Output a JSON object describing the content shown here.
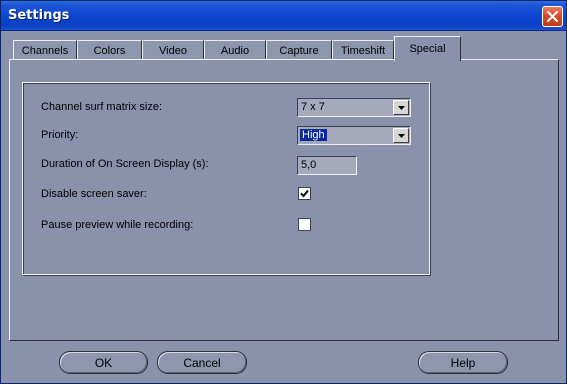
{
  "window": {
    "title": "Settings",
    "close_icon": "close-x-icon"
  },
  "tabs": [
    {
      "label": "Channels",
      "active": false
    },
    {
      "label": "Colors",
      "active": false
    },
    {
      "label": "Video",
      "active": false
    },
    {
      "label": "Audio",
      "active": false
    },
    {
      "label": "Capture",
      "active": false
    },
    {
      "label": "Timeshift",
      "active": false
    },
    {
      "label": "Special",
      "active": true
    }
  ],
  "special": {
    "surf_matrix": {
      "label": "Channel surf matrix size:",
      "value": "7 x 7"
    },
    "priority": {
      "label": "Priority:",
      "value": "High"
    },
    "osd_duration": {
      "label": "Duration of On Screen Display (s):",
      "value": "5,0"
    },
    "disable_screensaver": {
      "label": "Disable screen saver:",
      "checked": true
    },
    "pause_preview": {
      "label": "Pause preview while recording:",
      "checked": false
    }
  },
  "buttons": {
    "ok": "OK",
    "cancel": "Cancel",
    "help": "Help"
  },
  "colors": {
    "titlebar": "#0f4ad0",
    "window_bg": "#8893ab",
    "selection": "#0a2a9a"
  }
}
